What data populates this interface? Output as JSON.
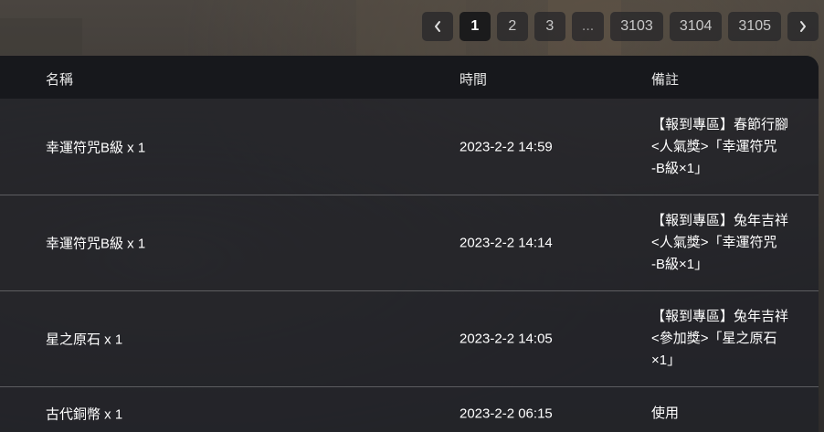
{
  "pagination": {
    "prev_icon": "chevron-left-icon",
    "next_icon": "chevron-right-icon",
    "pages": [
      "1",
      "2",
      "3",
      "...",
      "3103",
      "3104",
      "3105"
    ],
    "active_page": "1"
  },
  "table": {
    "headers": {
      "name": "名稱",
      "time": "時間",
      "note": "備註"
    },
    "rows": [
      {
        "name": "幸運符咒B級 x 1",
        "time": "2023-2-2 14:59",
        "note_lines": [
          "【報到專區】春節行腳",
          "<人氣獎>「幸運符咒",
          "-B級×1」"
        ]
      },
      {
        "name": "幸運符咒B級 x 1",
        "time": "2023-2-2 14:14",
        "note_lines": [
          "【報到專區】兔年吉祥",
          "<人氣獎>「幸運符咒",
          "-B級×1」"
        ]
      },
      {
        "name": "星之原石 x 1",
        "time": "2023-2-2 14:05",
        "note_lines": [
          "【報到專區】兔年吉祥",
          "<參加獎>「星之原石",
          "×1」"
        ]
      },
      {
        "name": "古代銅幣 x 1",
        "time": "2023-2-2 06:15",
        "note_lines": [
          "使用"
        ]
      }
    ]
  },
  "colors": {
    "header_bg": "#17181c",
    "panel_bg": "#212228",
    "active_page_bg": "#1b1b1c",
    "text": "#ffffff"
  }
}
